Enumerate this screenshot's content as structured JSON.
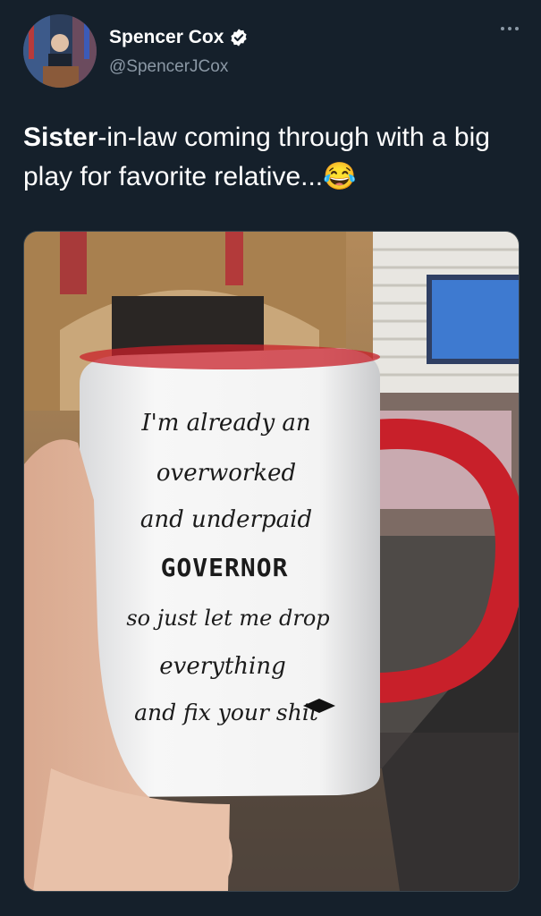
{
  "tweet": {
    "author_name": "Spencer Cox",
    "author_handle": "@SpencerJCox",
    "text_bold": "Sister",
    "text_rest": "-in-law coming through with a big play for favorite relative...",
    "emoji": "😂"
  },
  "mug_text": {
    "line1": "I'm already an",
    "line2": "overworked",
    "line3": "and underpaid",
    "line4": "GOVERNOR",
    "line5": "so just let me drop",
    "line6": "everything",
    "line7": "and fix your shit"
  },
  "colors": {
    "background": "#15202b",
    "secondary_text": "#8b98a5",
    "verified": "#ffffff",
    "mug_accent": "#c8202a"
  },
  "icons": {
    "verified": "verified-badge-icon",
    "more": "more-options-icon"
  }
}
